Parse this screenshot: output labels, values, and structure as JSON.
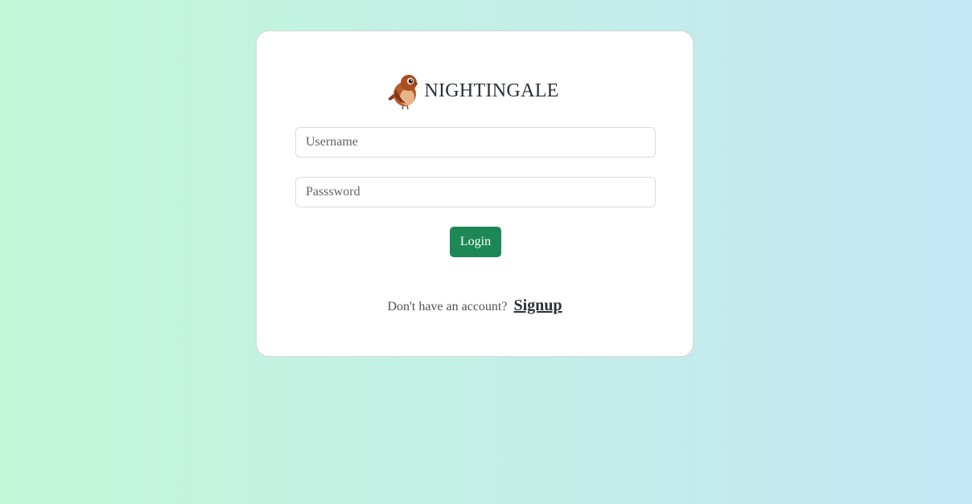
{
  "brand": {
    "name": "NIGHTINGALE",
    "logo_icon": "nightingale-bird-icon"
  },
  "form": {
    "username_placeholder": "Username",
    "username_value": "",
    "password_placeholder": "Passsword",
    "password_value": "",
    "login_label": "Login"
  },
  "signup": {
    "prompt": "Don't have an account?",
    "link_label": "Signup"
  },
  "colors": {
    "background_start": "#c1f8d8",
    "background_end": "#c5e6f5",
    "login_button": "#1d8856",
    "card": "#ffffff"
  }
}
